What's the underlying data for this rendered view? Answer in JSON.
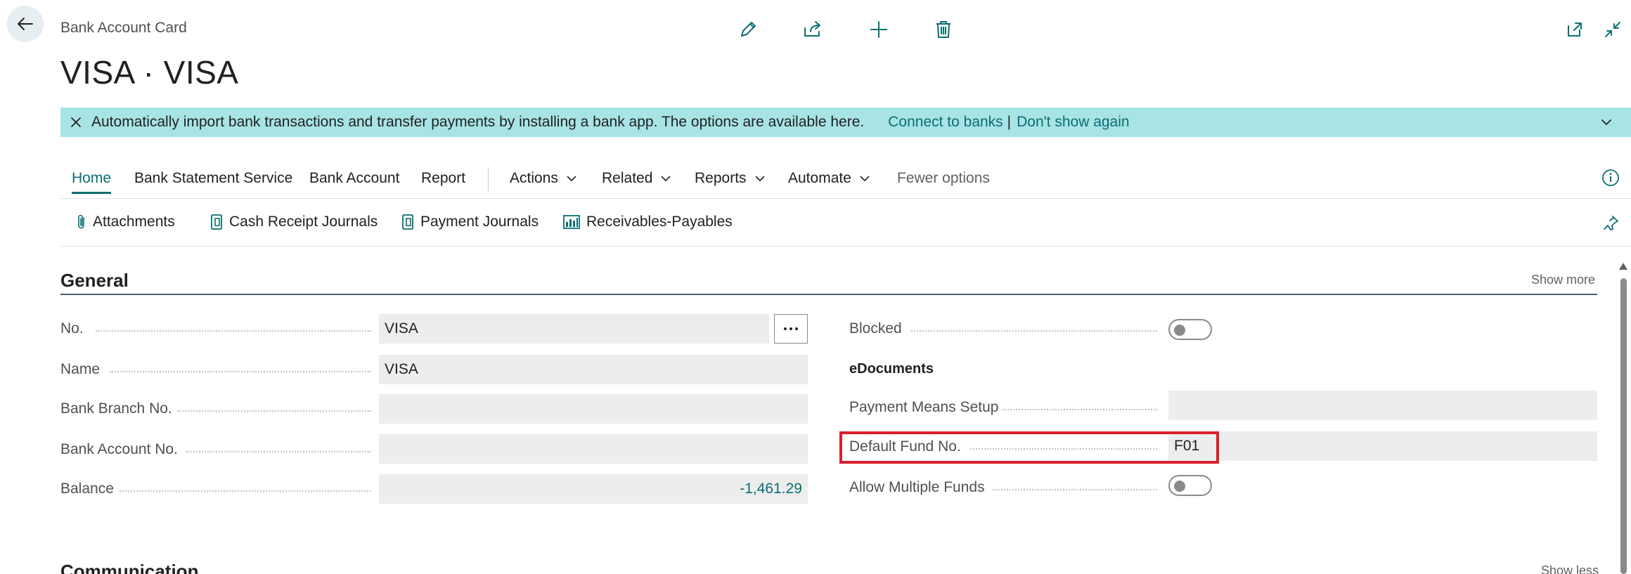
{
  "header": {
    "caption": "Bank Account Card",
    "title": "VISA · VISA"
  },
  "banner": {
    "message": "Automatically import bank transactions and transfer payments by installing a bank app. The options are available here.",
    "link_connect": "Connect to banks",
    "separator": "|",
    "link_dismiss": "Don't show again"
  },
  "menu": {
    "items": [
      {
        "label": "Home",
        "active": true
      },
      {
        "label": "Bank Statement Service"
      },
      {
        "label": "Bank Account"
      },
      {
        "label": "Report"
      },
      {
        "label": "Actions",
        "dropdown": true
      },
      {
        "label": "Related",
        "dropdown": true
      },
      {
        "label": "Reports",
        "dropdown": true
      },
      {
        "label": "Automate",
        "dropdown": true
      },
      {
        "label": "Fewer options"
      }
    ]
  },
  "actions": [
    {
      "label": "Attachments",
      "icon": "paperclip-icon"
    },
    {
      "label": "Cash Receipt Journals",
      "icon": "journal-icon"
    },
    {
      "label": "Payment Journals",
      "icon": "journal-icon"
    },
    {
      "label": "Receivables-Payables",
      "icon": "chart-icon"
    }
  ],
  "general": {
    "title": "General",
    "show_more": "Show more",
    "left_fields": [
      {
        "label": "No.",
        "value": "VISA"
      },
      {
        "label": "Name",
        "value": "VISA"
      },
      {
        "label": "Bank Branch No.",
        "value": ""
      },
      {
        "label": "Bank Account No.",
        "value": ""
      },
      {
        "label": "Balance",
        "value": "-1,461.29"
      }
    ],
    "blocked_label": "Blocked",
    "blocked_on": false,
    "edocuments_heading": "eDocuments",
    "payment_means_label": "Payment Means Setup",
    "payment_means_value": "",
    "default_fund_label": "Default Fund No.",
    "default_fund_value": "F01",
    "allow_multiple_label": "Allow Multiple Funds",
    "allow_multiple_on": false
  },
  "communication": {
    "title": "Communication",
    "show_less": "Show less"
  },
  "colors": {
    "accent": "#0b6e71",
    "banner": "#a8e4e6",
    "highlight": "#d9202b"
  }
}
